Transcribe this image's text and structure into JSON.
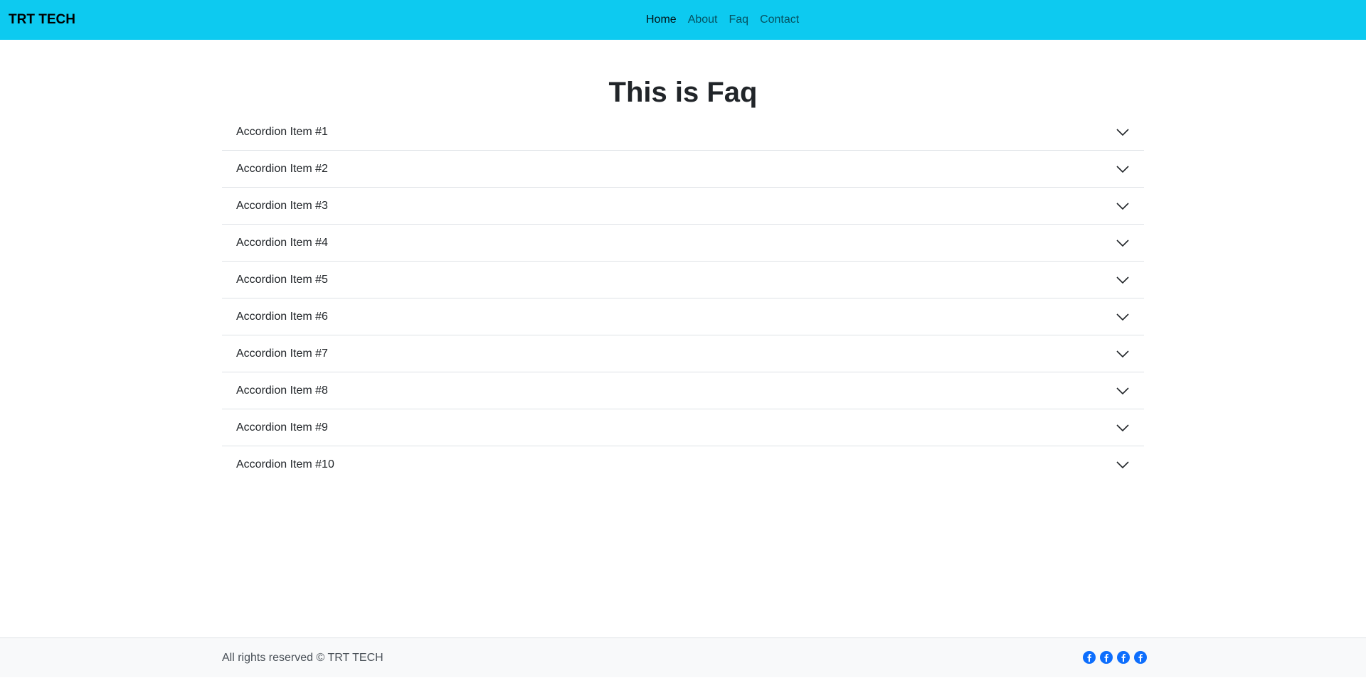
{
  "navbar": {
    "brand": "TRT TECH",
    "links": [
      {
        "label": "Home",
        "active": true
      },
      {
        "label": "About",
        "active": false
      },
      {
        "label": "Faq",
        "active": false
      },
      {
        "label": "Contact",
        "active": false
      }
    ],
    "background_color": "#0dcaf0"
  },
  "main": {
    "title": "This is Faq",
    "accordion": [
      {
        "label": "Accordion Item #1",
        "icon": "chevron-down-icon"
      },
      {
        "label": "Accordion Item #2",
        "icon": "chevron-down-icon"
      },
      {
        "label": "Accordion Item #3",
        "icon": "chevron-down-icon"
      },
      {
        "label": "Accordion Item #4",
        "icon": "chevron-down-icon"
      },
      {
        "label": "Accordion Item #5",
        "icon": "chevron-down-icon"
      },
      {
        "label": "Accordion Item #6",
        "icon": "chevron-down-icon"
      },
      {
        "label": "Accordion Item #7",
        "icon": "chevron-down-icon"
      },
      {
        "label": "Accordion Item #8",
        "icon": "chevron-down-icon"
      },
      {
        "label": "Accordion Item #9",
        "icon": "chevron-down-icon"
      },
      {
        "label": "Accordion Item #10",
        "icon": "chevron-down-icon"
      }
    ]
  },
  "footer": {
    "copyright": "All rights reserved © TRT TECH",
    "social_icons": [
      "facebook-icon",
      "facebook-icon",
      "facebook-icon",
      "facebook-icon"
    ],
    "social_color": "#0d6efd",
    "background_color": "#f8f9fa"
  }
}
